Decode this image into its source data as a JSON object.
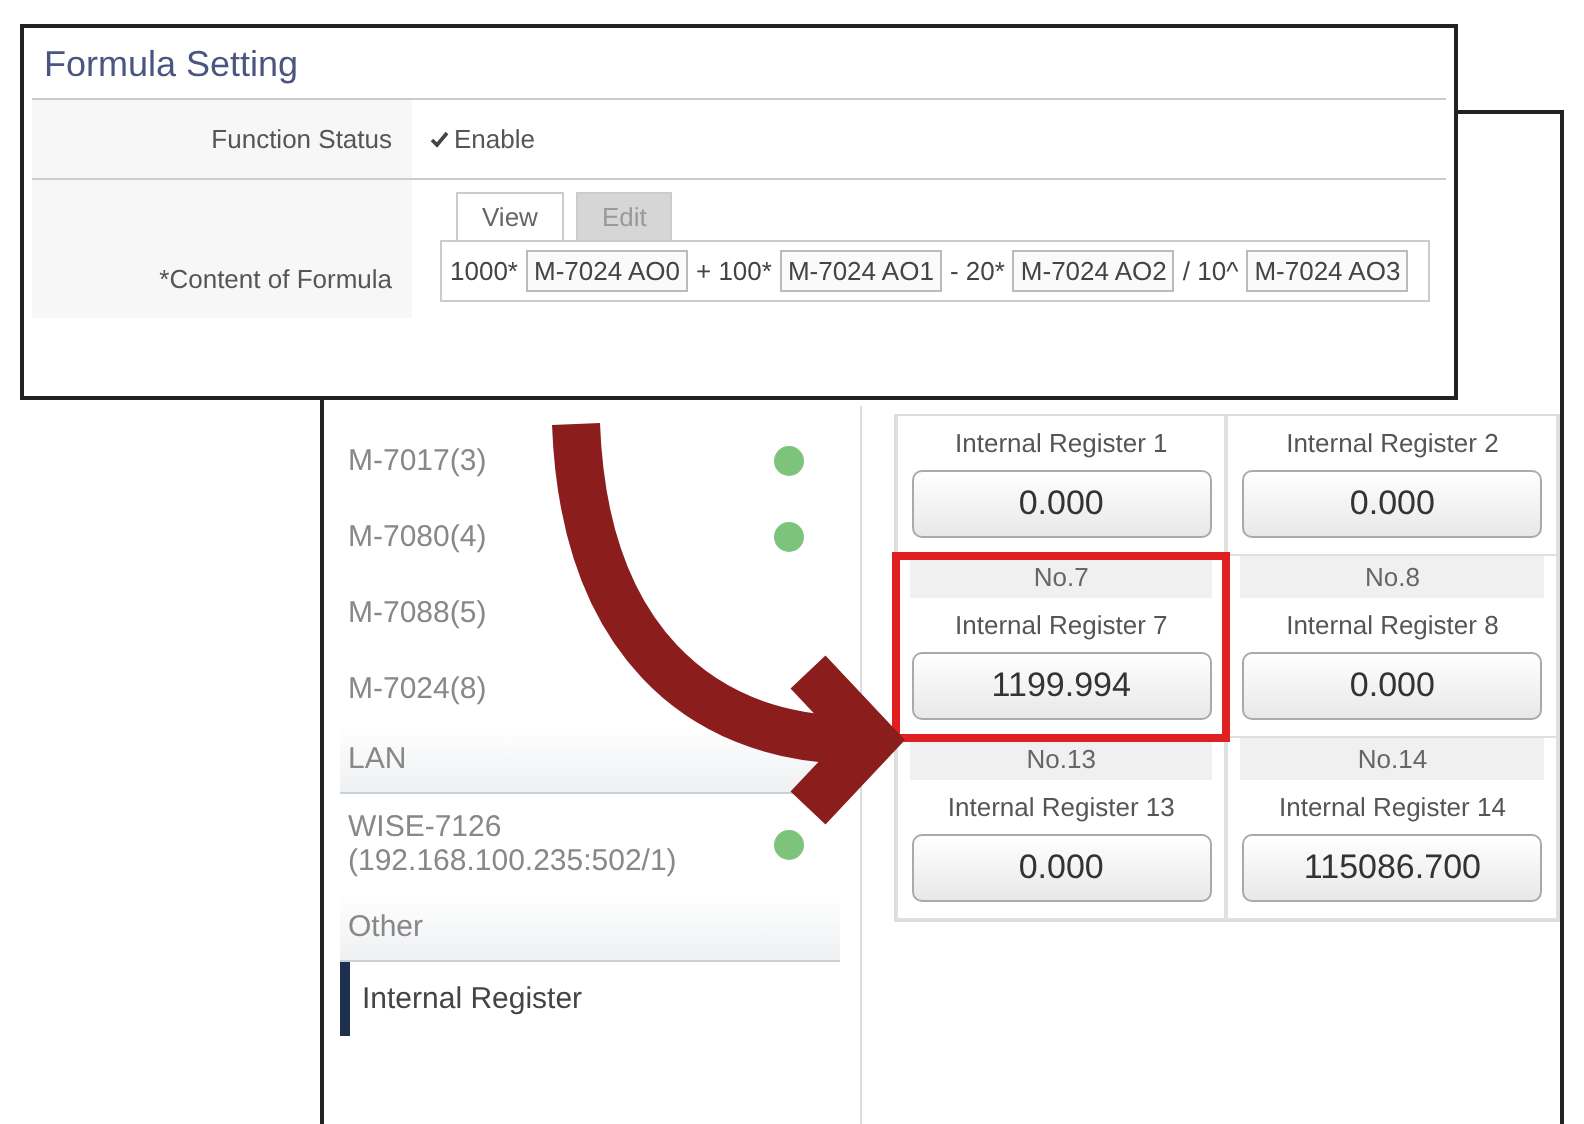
{
  "formula_setting": {
    "title": "Formula Setting",
    "function_status": {
      "label": "Function Status",
      "checkbox": {
        "label": "Enable",
        "checked": true
      }
    },
    "content": {
      "label": "*Content of Formula",
      "tabs": [
        {
          "label": "View",
          "selected": true
        },
        {
          "label": "Edit",
          "selected": false
        }
      ],
      "formula": [
        {
          "kind": "text",
          "text": "1000*"
        },
        {
          "kind": "variable",
          "text": "M-7024 AO0"
        },
        {
          "kind": "text",
          "text": "+ 100*"
        },
        {
          "kind": "variable",
          "text": "M-7024 AO1"
        },
        {
          "kind": "text",
          "text": "- 20*"
        },
        {
          "kind": "variable",
          "text": "M-7024 AO2"
        },
        {
          "kind": "text",
          "text": "/ 10^"
        },
        {
          "kind": "variable",
          "text": "M-7024 AO3"
        }
      ]
    }
  },
  "sidebar": {
    "items": [
      {
        "kind": "device",
        "label": "M-7017(3)",
        "online": true
      },
      {
        "kind": "device",
        "label": "M-7080(4)",
        "online": true
      },
      {
        "kind": "device",
        "label": "M-7088(5)",
        "online": false
      },
      {
        "kind": "device",
        "label": "M-7024(8)",
        "online": false
      },
      {
        "kind": "header",
        "label": "LAN"
      },
      {
        "kind": "device",
        "label": "WISE-7126\n(192.168.100.235:502/1)",
        "online": true
      },
      {
        "kind": "header",
        "label": "Other"
      },
      {
        "kind": "link",
        "label": "Internal Register",
        "selected": true
      }
    ]
  },
  "registers": [
    {
      "label": "Internal Register 1",
      "value": "0.000",
      "highlighted": false
    },
    {
      "label": "Internal Register 2",
      "value": "0.000",
      "highlighted": false
    },
    {
      "number": "No.7",
      "label": "Internal Register 7",
      "value": "1199.994",
      "highlighted": true
    },
    {
      "number": "No.8",
      "label": "Internal Register 8",
      "value": "0.000",
      "highlighted": false
    },
    {
      "number": "No.13",
      "label": "Internal Register 13",
      "value": "0.000",
      "highlighted": false
    },
    {
      "number": "No.14",
      "label": "Internal Register 14",
      "value": "115086.700",
      "highlighted": false
    }
  ]
}
